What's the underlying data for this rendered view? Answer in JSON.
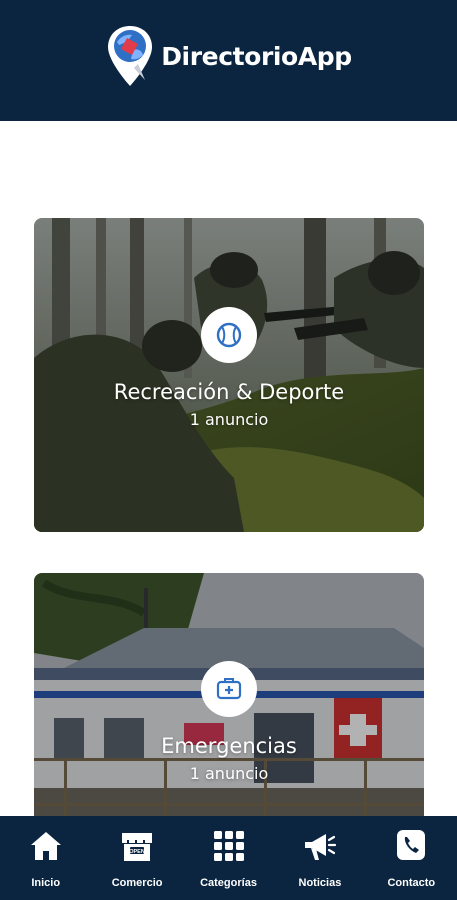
{
  "header": {
    "app_name": "DirectorioApp",
    "logo_icon": "map-pin-globe-icon"
  },
  "colors": {
    "navy": "#0b2540",
    "accent_blue": "#3a7bd5",
    "icon_blue": "#2f6fc4"
  },
  "cards": [
    {
      "title": "Recreación & Deporte",
      "count": "1 anuncio",
      "icon": "baseball-icon",
      "image": "paintball-players-in-forest"
    },
    {
      "title": "Emergencias",
      "count": "1 anuncio",
      "icon": "medical-kit-icon",
      "image": "medical-building"
    }
  ],
  "nav": [
    {
      "label": "Inicio",
      "icon": "home-icon"
    },
    {
      "label": "Comercio",
      "icon": "store-icon"
    },
    {
      "label": "Categorías",
      "icon": "grid-icon"
    },
    {
      "label": "Noticias",
      "icon": "megaphone-icon"
    },
    {
      "label": "Contacto",
      "icon": "phone-icon"
    }
  ]
}
